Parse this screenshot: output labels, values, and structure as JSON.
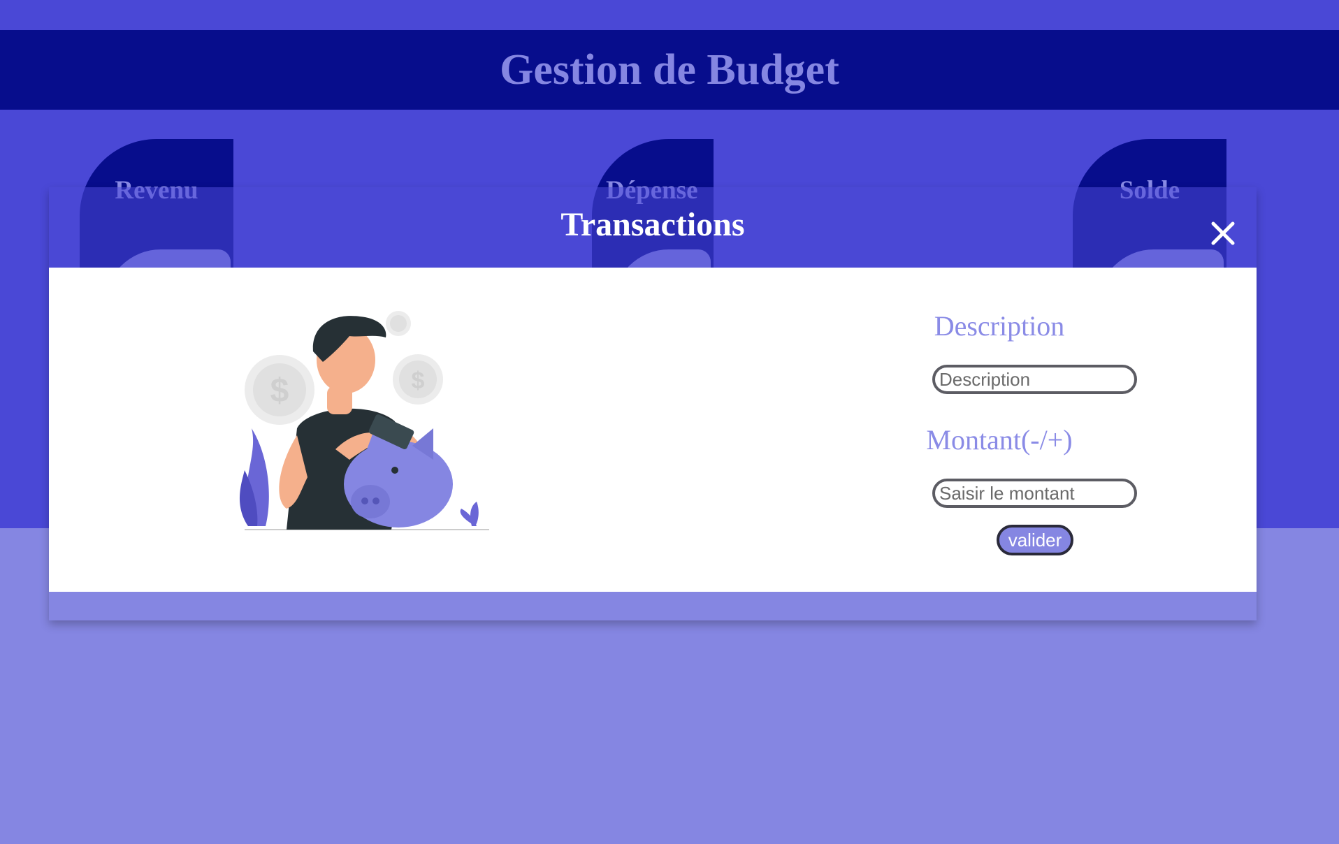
{
  "header": {
    "title": "Gestion de Budget"
  },
  "cards": {
    "revenu": "Revenu",
    "depense": "Dépense",
    "solde": "Solde"
  },
  "modal": {
    "title": "Transactions",
    "close_icon": "close-icon"
  },
  "form": {
    "description_label": "Description",
    "description_placeholder": "Description",
    "amount_label": "Montant(-/+)",
    "amount_placeholder": "Saisir le montant",
    "submit_label": "valider"
  },
  "illustration": {
    "icon": "man-piggy-bank-illustration"
  },
  "colors": {
    "background_top": "#4a48d6",
    "background_bottom": "#8586e2",
    "header": "#070d8c",
    "accent": "#8586e2"
  }
}
